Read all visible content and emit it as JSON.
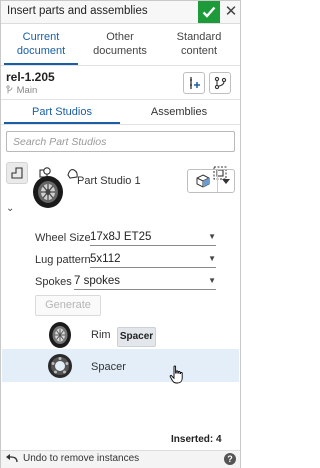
{
  "dialog": {
    "title": "Insert parts and assemblies"
  },
  "source_tabs": [
    {
      "line1": "Current",
      "line2": "document",
      "active": true
    },
    {
      "line1": "Other",
      "line2": "documents",
      "active": false
    },
    {
      "line1": "Standard",
      "line2": "content",
      "active": false
    }
  ],
  "document": {
    "name": "rel-1.205",
    "branch": "Main"
  },
  "studio_tabs": [
    {
      "label": "Part Studios",
      "active": true
    },
    {
      "label": "Assemblies",
      "active": false
    }
  ],
  "search": {
    "placeholder": "Search Part Studios",
    "value": ""
  },
  "tree": {
    "part_studio": {
      "name": "Part Studio 1"
    },
    "configurations": [
      {
        "label": "Wheel Size",
        "value": "17x8J ET25"
      },
      {
        "label": "Lug pattern",
        "value": "5x112"
      },
      {
        "label": "Spokes",
        "value": "7 spokes"
      }
    ],
    "generate_label": "Generate",
    "parts": [
      {
        "name": "Rim"
      },
      {
        "name": "Spacer"
      }
    ],
    "tooltip": "Spacer"
  },
  "footer": {
    "inserted": "Inserted: 4",
    "undo": "Undo to remove instances",
    "help": "?"
  },
  "colors": {
    "accent": "#1a5fa5",
    "ok": "#1d9b3b",
    "highlight": "#e3eef8"
  }
}
